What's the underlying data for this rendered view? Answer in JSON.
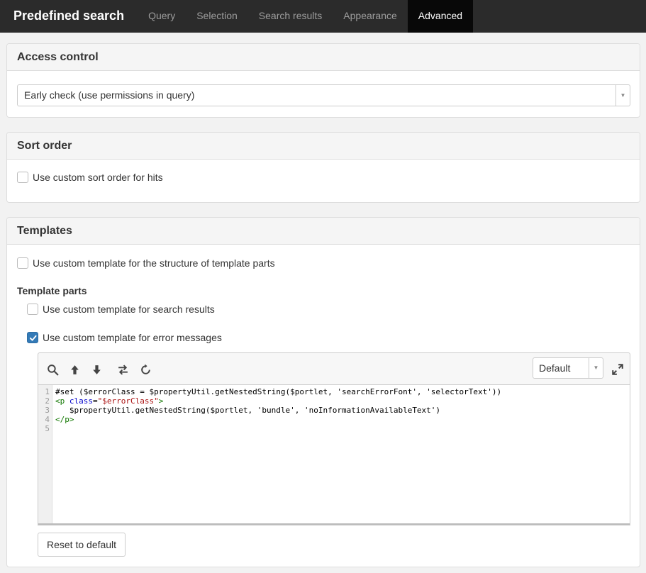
{
  "app": {
    "title": "Predefined search"
  },
  "tabs": [
    {
      "label": "Query"
    },
    {
      "label": "Selection"
    },
    {
      "label": "Search results"
    },
    {
      "label": "Appearance"
    },
    {
      "label": "Advanced",
      "active": true
    }
  ],
  "access_control": {
    "heading": "Access control",
    "select_value": "Early check (use permissions in query)"
  },
  "sort_order": {
    "heading": "Sort order",
    "custom_sort": {
      "label": "Use custom sort order for hits",
      "checked": false
    }
  },
  "templates": {
    "heading": "Templates",
    "custom_structure": {
      "label": "Use custom template for the structure of template parts",
      "checked": false
    },
    "parts_heading": "Template parts",
    "search_results": {
      "label": "Use custom template for search results",
      "checked": false
    },
    "error_messages": {
      "label": "Use custom template for error messages",
      "checked": true
    },
    "editor": {
      "mode": "Default",
      "toolbar_icons": [
        "search-icon",
        "arrow-up-icon",
        "arrow-down-icon",
        "swap-icon",
        "refresh-icon",
        "expand-icon"
      ],
      "line_numbers": [
        "1",
        "2",
        "3",
        "4",
        "5"
      ],
      "lines": [
        "#set ($errorClass = $propertyUtil.getNestedString($portlet, 'searchErrorFont', 'selectorText'))",
        "<p class=\"$errorClass\">",
        "   $propertyUtil.getNestedString($portlet, 'bundle', 'noInformationAvailableText')",
        "</p>",
        ""
      ],
      "line2_parts": {
        "open": "<p",
        "attr": " class",
        "eq": "=",
        "val": "\"$errorClass\"",
        "close": ">"
      },
      "line4": "</p>"
    },
    "reset_button": "Reset to default"
  },
  "colors": {
    "navbar": "#2b2b2b",
    "active_tab": "#080808",
    "accent": "#337ab7"
  }
}
